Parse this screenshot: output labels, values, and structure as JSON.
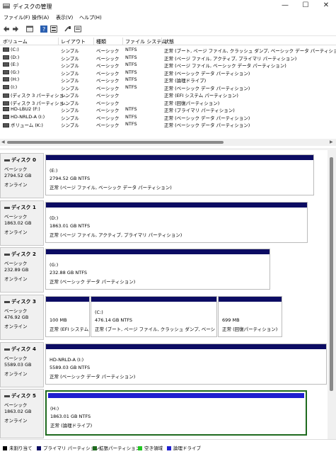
{
  "window": {
    "title": "ディスクの管理",
    "minimize": "—",
    "maximize": "☐",
    "close": "✕"
  },
  "menu": [
    "ファイル(F)",
    "操作(A)",
    "表示(V)",
    "ヘルプ(H)"
  ],
  "toolbar_icons": [
    "back-arrow-icon",
    "forward-arrow-icon",
    "properties-icon",
    "help-icon",
    "view-icon",
    "connect-icon",
    "settings-icon"
  ],
  "volume_table": {
    "columns": [
      "ボリューム",
      "レイアウト",
      "種類",
      "ファイル システム",
      "状態"
    ],
    "rows": [
      {
        "volume": "(C:)",
        "layout": "シンプル",
        "type": "ベーシック",
        "fs": "NTFS",
        "status": "正常 (ブート, ページ ファイル, クラッシュ ダンプ, ベーシック データ パーティション)"
      },
      {
        "volume": "(D:)",
        "layout": "シンプル",
        "type": "ベーシック",
        "fs": "NTFS",
        "status": "正常 (ページ ファイル, アクティブ, プライマリ パーティション)"
      },
      {
        "volume": "(E:)",
        "layout": "シンプル",
        "type": "ベーシック",
        "fs": "NTFS",
        "status": "正常 (ページ ファイル, ベーシック データ パーティション)"
      },
      {
        "volume": "(G:)",
        "layout": "シンプル",
        "type": "ベーシック",
        "fs": "NTFS",
        "status": "正常 (ベーシック データ パーティション)"
      },
      {
        "volume": "(H:)",
        "layout": "シンプル",
        "type": "ベーシック",
        "fs": "NTFS",
        "status": "正常 (論理ドライブ)"
      },
      {
        "volume": "(I:)",
        "layout": "シンプル",
        "type": "ベーシック",
        "fs": "NTFS",
        "status": "正常 (ベーシック データ パーティション)"
      },
      {
        "volume": "(ディスク 3 パーティショ...",
        "layout": "シンプル",
        "type": "ベーシック",
        "fs": "",
        "status": "正常 (EFI システム パーティション)"
      },
      {
        "volume": "(ディスク 3 パーティショ...",
        "layout": "シンプル",
        "type": "ベーシック",
        "fs": "",
        "status": "正常 (回復パーティション)"
      },
      {
        "volume": "HD-LBU2 (F:)",
        "layout": "シンプル",
        "type": "ベーシック",
        "fs": "NTFS",
        "status": "正常 (プライマリ パーティション)"
      },
      {
        "volume": "HD-NRLD-A (I:)",
        "layout": "シンプル",
        "type": "ベーシック",
        "fs": "NTFS",
        "status": "正常 (ベーシック データ パーティション)"
      },
      {
        "volume": "ボリューム (K:)",
        "layout": "シンプル",
        "type": "ベーシック",
        "fs": "NTFS",
        "status": "正常 (ベーシック データ パーティション)"
      }
    ]
  },
  "disks": [
    {
      "name": "ディスク 0",
      "type": "ベーシック",
      "size": "2794.52 GB",
      "state": "オンライン",
      "partitions": [
        {
          "label": "(E:)",
          "size": "2794.52 GB NTFS",
          "status": "正常 (ページ ファイル, ベーシック データ パーティション)"
        }
      ]
    },
    {
      "name": "ディスク 1",
      "type": "ベーシック",
      "size": "1863.02 GB",
      "state": "オンライン",
      "partitions": [
        {
          "label": "(D:)",
          "size": "1863.01 GB NTFS",
          "status": "正常 (ページ ファイル, アクティブ, プライマリ パーティション)"
        }
      ]
    },
    {
      "name": "ディスク 2",
      "type": "ベーシック",
      "size": "232.89 GB",
      "state": "オンライン",
      "partitions": [
        {
          "label": "(G:)",
          "size": "232.88 GB NTFS",
          "status": "正常 (ベーシック データ パーティション)"
        }
      ]
    },
    {
      "name": "ディスク 3",
      "type": "ベーシック",
      "size": "476.92 GB",
      "state": "オンライン",
      "partitions": [
        {
          "label": "",
          "size": "100 MB",
          "status": "正常 (EFI システム"
        },
        {
          "label": "(C:)",
          "size": "476.14 GB NTFS",
          "status": "正常 (ブート, ページ ファイル, クラッシュ ダンプ, ベーシック デー"
        },
        {
          "label": "",
          "size": "699 MB",
          "status": "正常 (回復パーティション)"
        }
      ]
    },
    {
      "name": "ディスク 4",
      "type": "ベーシック",
      "size": "5589.03 GB",
      "state": "オンライン",
      "partitions": [
        {
          "label": "HD-NRLD-A (I:)",
          "size": "5589.03 GB NTFS",
          "status": "正常 (ベーシック データ パーティション)"
        }
      ]
    },
    {
      "name": "ディスク 5",
      "type": "ベーシック",
      "size": "1863.02 GB",
      "state": "オンライン",
      "partitions": [
        {
          "label": "(H:)",
          "size": "1863.01 GB NTFS",
          "status": "正常 (論理ドライブ)"
        }
      ]
    }
  ],
  "legend": [
    {
      "label": "未割り当て",
      "color": "#000000"
    },
    {
      "label": "プライマリ パーティション",
      "color": "#0c0c63"
    },
    {
      "label": "拡張パーティション",
      "color": "#1e6a1e"
    },
    {
      "label": "空き領域",
      "color": "#22c622"
    },
    {
      "label": "論理ドライブ",
      "color": "#1f1fd0"
    }
  ]
}
